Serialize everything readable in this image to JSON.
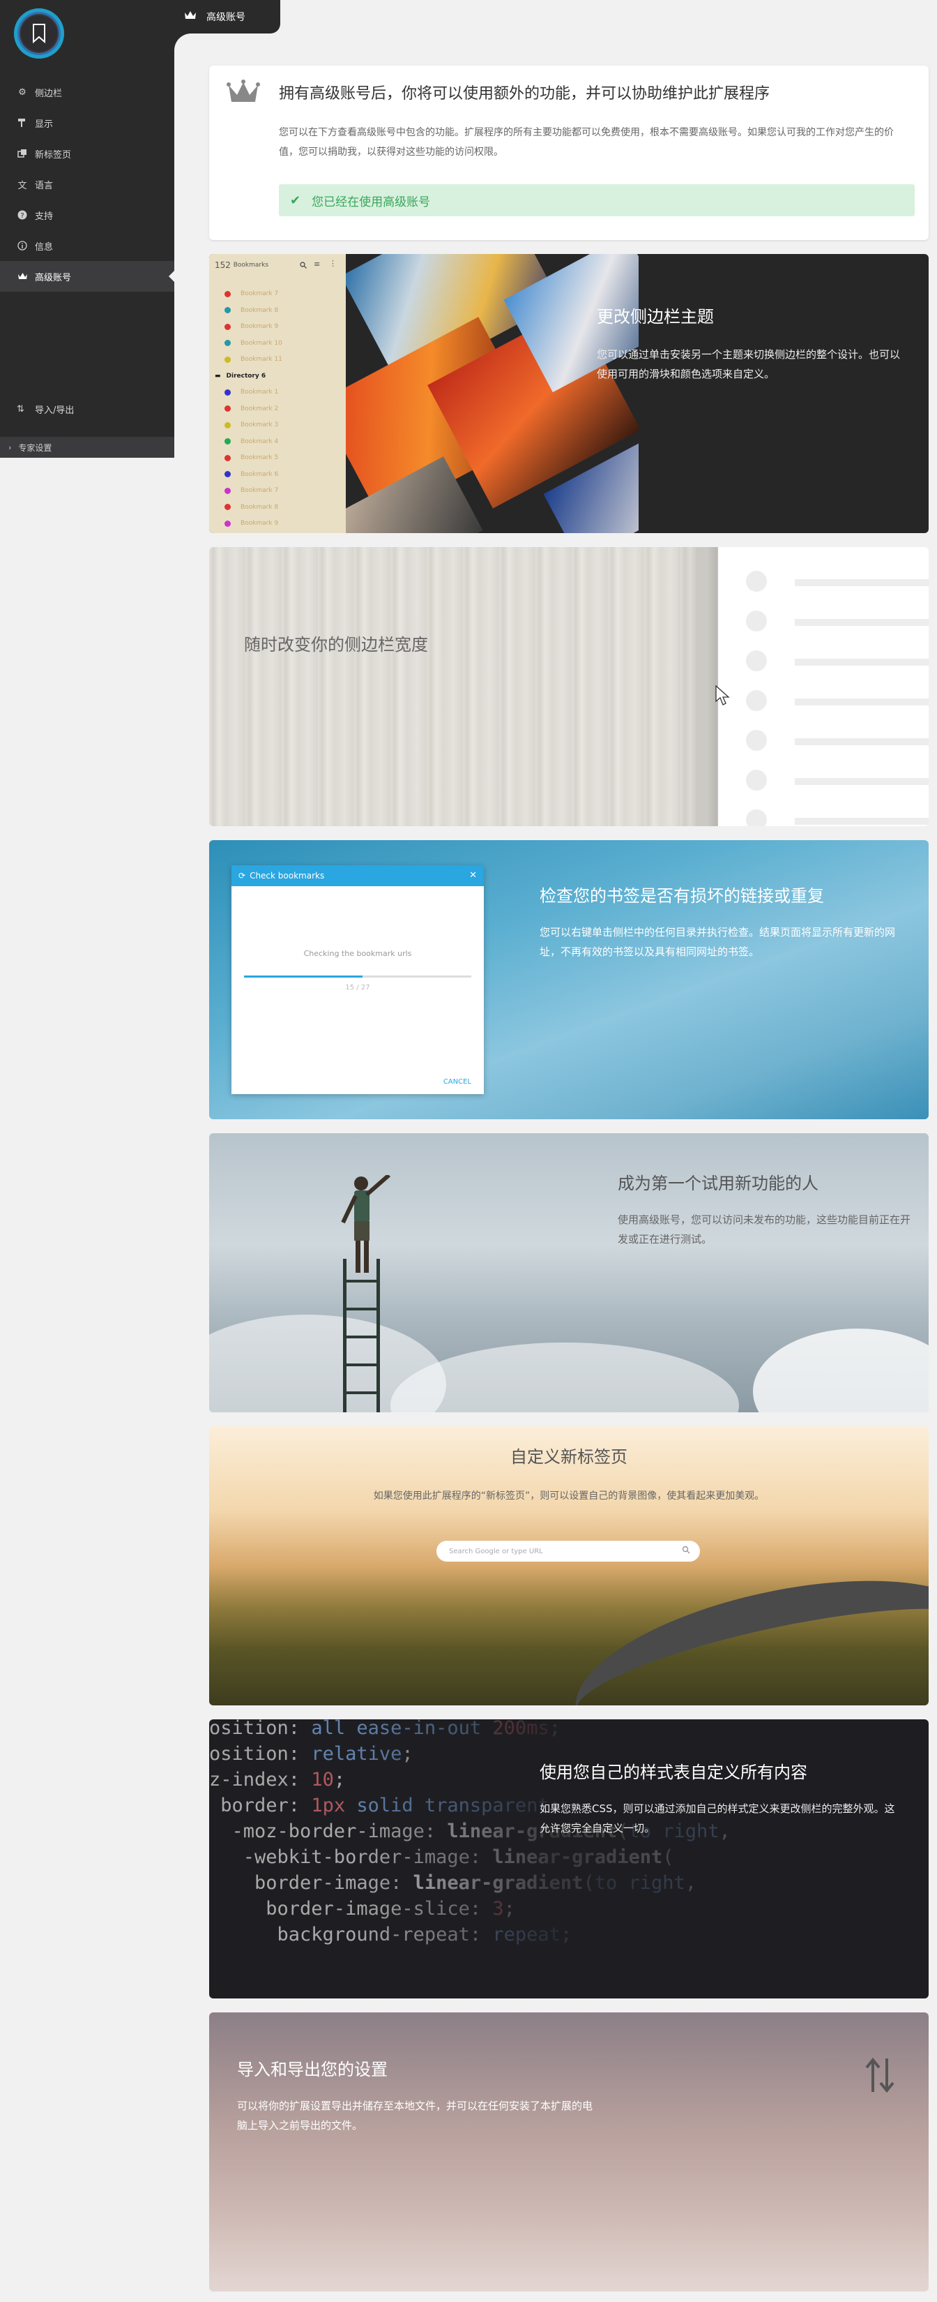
{
  "header": {
    "title": "高级账号"
  },
  "sidebar": {
    "items": [
      {
        "label": "侧边栏",
        "icon": "gear-icon"
      },
      {
        "label": "显示",
        "icon": "paint-roller-icon"
      },
      {
        "label": "新标签页",
        "icon": "tabs-icon"
      },
      {
        "label": "语言",
        "icon": "translate-icon"
      },
      {
        "label": "支持",
        "icon": "help-icon"
      },
      {
        "label": "信息",
        "icon": "info-icon"
      },
      {
        "label": "高级账号",
        "icon": "crown-icon"
      }
    ],
    "export_label": "导入/导出",
    "expert_label": "专家设置"
  },
  "intro": {
    "title": "拥有高级账号后，你将可以使用额外的功能，并可以协助维护此扩展程序",
    "text": "您可以在下方查看高级账号中包含的功能。扩展程序的所有主要功能都可以免费使用，根本不需要高级账号。如果您认可我的工作对您产生的价值，您可以捐助我，以获得对这些功能的访问权限。",
    "status": "您已经在使用高级账号"
  },
  "features": {
    "theme": {
      "title": "更改侧边栏主题",
      "text": "您可以通过单击安装另一个主题来切换侧边栏的整个设计。也可以使用可用的滑块和颜色选项来自定义。",
      "mini_count": "152",
      "mini_label": "Bookmarks",
      "mini_directory": "Directory 6",
      "mini_items": [
        "Bookmark 7",
        "Bookmark 8",
        "Bookmark 9",
        "Bookmark 10",
        "Bookmark 11",
        "",
        "Bookmark 1",
        "Bookmark 2",
        "Bookmark 3",
        "Bookmark 4",
        "Bookmark 5",
        "Bookmark 6",
        "Bookmark 7",
        "Bookmark 8",
        "Bookmark 9"
      ]
    },
    "width": {
      "title": "随时改变你的侧边栏宽度"
    },
    "check": {
      "title": "检查您的书签是否有损坏的链接或重复",
      "text": "您可以右键单击侧栏中的任何目录并执行检查。结果页面将显示所有更新的网址，不再有效的书签以及具有相同网址的书签。",
      "dialog_title": "Check bookmarks",
      "dialog_text": "Checking the bookmark urls",
      "dialog_count": "15 / 27",
      "dialog_progress": 0.52,
      "dialog_cancel": "CANCEL"
    },
    "beta": {
      "title": "成为第一个试用新功能的人",
      "text": "使用高级账号，您可以访问未发布的功能，这些功能目前正在开发或正在进行测试。"
    },
    "newtab": {
      "title": "自定义新标签页",
      "text": "如果您使用此扩展程序的“新标签页”，则可以设置自己的背景图像，使其看起来更加美观。",
      "search_placeholder": "Search Google or type URL"
    },
    "css": {
      "title": "使用您自己的样式表自定义所有内容",
      "text": "如果您熟悉CSS，则可以通过添加自己的样式定义来更改侧栏的完整外观。这允许您完全自定义一切。"
    },
    "import": {
      "title": "导入和导出您的设置",
      "text": "可以将你的扩展设置导出并储存至本地文件，并可以在任何安装了本扩展的电脑上导入之前导出的文件。"
    }
  },
  "colors": {
    "accent": "#2aa6e0",
    "success_bg": "#d8f1de",
    "success_text": "#39a65b",
    "sidebar_bg": "#2b2a2b"
  }
}
